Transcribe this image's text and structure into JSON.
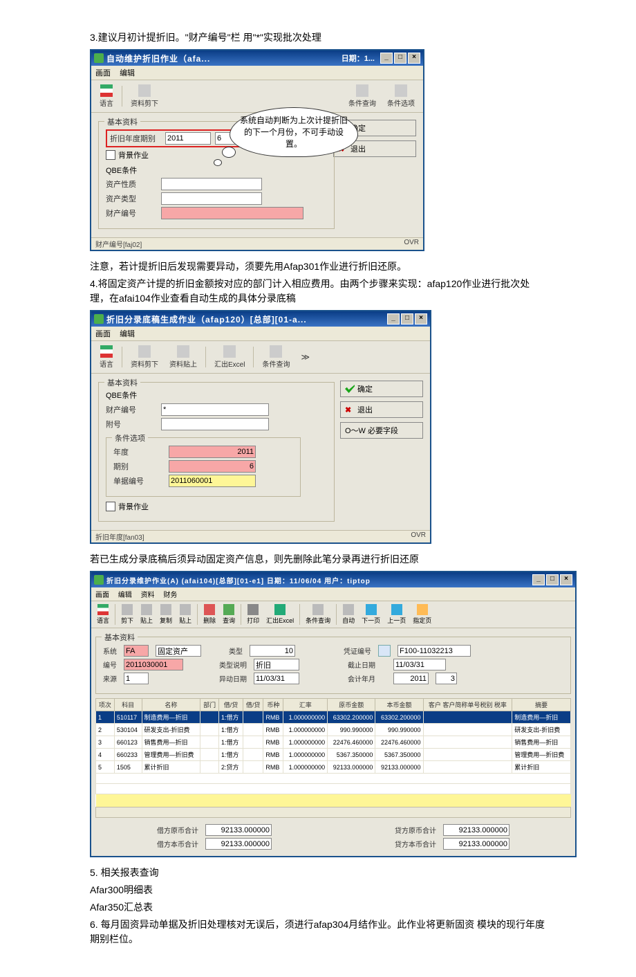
{
  "doc": {
    "p3": "3.建议月初计提折旧。\"财产编号\"栏 用\"*\"实现批次处理",
    "p3_note": "注意，若计提折旧后发现需要异动，须要先用Afap301作业进行折旧还原。",
    "p4": "4.将固定资产计提的折旧金额按对应的部门计入相应费用。由两个步骤来实现：afap120作业进行批次处理，在afai104作业查看自动生成的具体分录底稿",
    "p4b": "若已生成分录底稿后须异动固定资产信息，则先删除此笔分录再进行折旧还原",
    "p5": "5.  相关报表查询",
    "p5a": "Afar300明细表",
    "p5b": "Afar350汇总表",
    "p6": "6.  每月固资异动单据及折旧处理核对无误后，须进行afap304月结作业。此作业将更新固资  模块的现行年度期别栏位。"
  },
  "win1": {
    "title_left": "自动维护折旧作业（afa...",
    "title_right": "日期：1...",
    "menu": [
      "画面",
      "编辑"
    ],
    "toolbar": {
      "lang": "语言",
      "cut": "资料剪下"
    },
    "toolbar_right": {
      "query": "条件查询",
      "cond": "条件选项"
    },
    "speech": "系统自动判断为上次计提折旧的下一个月份，不可手动设置。",
    "group_title": "基本资料",
    "year_label": "折旧年度期别",
    "year": "2011",
    "period": "6",
    "bg_label": "背景作业",
    "qbe_title": "QBE条件",
    "qbe": [
      {
        "label": "资产性质",
        "val": ""
      },
      {
        "label": "资产类型",
        "val": ""
      },
      {
        "label": "财产编号",
        "val": "",
        "pink": true
      }
    ],
    "btns": {
      "ok": "确定",
      "exit": "退出"
    },
    "status_left": "财产编号[faj02]",
    "status_right": "OVR"
  },
  "win2": {
    "title": "折旧分录底稿生成作业（afap120）[总部][01-a...",
    "menu": [
      "画面",
      "编辑"
    ],
    "toolbar": [
      "语言",
      "资料剪下",
      "资料贴上",
      "汇出Excel",
      "条件查询"
    ],
    "group_title": "基本资料",
    "qbe_title": "QBE条件",
    "fld_prop": "财产编号",
    "fld_prop_val": "*",
    "fld_att": "附号",
    "opt_title": "条件选项",
    "opt_year_label": "年度",
    "opt_year": "2011",
    "opt_period_label": "期别",
    "opt_period": "6",
    "opt_docno_label": "单据编号",
    "opt_docno": "2011060001",
    "bg_label": "背景作业",
    "btns": {
      "ok": "确定",
      "exit": "退出",
      "must": "O～W 必要字段"
    },
    "status_left": "折旧年度[fan03]",
    "status_right": "OVR"
  },
  "win3": {
    "title": "折旧分录维护作业(A) (afai104)[总部][01-e1]   日期：11/06/04   用户：tiptop",
    "menu": [
      "画面",
      "编辑",
      "资料",
      "财务"
    ],
    "toolbar": [
      "语言",
      "剪下",
      "贴上",
      "复制",
      "贴上",
      "删除",
      "查询",
      "打印",
      "汇出Excel",
      "条件查询",
      "自动",
      "下一页",
      "上一页",
      "指定页"
    ],
    "group_title": "基本资料",
    "fields": {
      "sys_l": "系统",
      "sys_v": "FA",
      "sys_t": "固定资产",
      "type_l": "类型",
      "type_v": "10",
      "typedet_l": "类型说明",
      "typedet_v": "折旧",
      "voucher_l": "凭证编号",
      "voucher_v": "F100-11032213",
      "no_l": "编号",
      "no_v": "2011030001",
      "cutoff_l": "截止日期",
      "cutoff_v": "11/03/31",
      "src_l": "来源",
      "src_v": "1",
      "movedate_l": "异动日期",
      "movedate_v": "11/03/31",
      "acctym_l": "会计年月",
      "acctym_y": "2011",
      "acctym_m": "3"
    },
    "cols": [
      "项次",
      "科目",
      "名称",
      "部门",
      "借/贷",
      "借/贷",
      "币种",
      "汇率",
      "原币金额",
      "本币金额",
      "客户 客户简称单号税别 税率",
      "摘要"
    ],
    "rows": [
      {
        "seq": "1",
        "subj": "510117",
        "name": "制造费用—折旧",
        "dept": "",
        "dc1": "1:借方",
        "dc2": "RMB",
        "rate": "1.000000000",
        "orig": "63302.200000",
        "local": "63302.200000",
        "cust": "",
        "memo": "制造费用—折旧",
        "sel": true
      },
      {
        "seq": "2",
        "subj": "530104",
        "name": "研发支出-折旧费",
        "dept": "",
        "dc1": "1:借方",
        "dc2": "RMB",
        "rate": "1.000000000",
        "orig": "990.990000",
        "local": "990.990000",
        "cust": "",
        "memo": "研发支出-折旧费"
      },
      {
        "seq": "3",
        "subj": "660123",
        "name": "销售费用—折旧",
        "dept": "",
        "dc1": "1:借方",
        "dc2": "RMB",
        "rate": "1.000000000",
        "orig": "22476.460000",
        "local": "22476.460000",
        "cust": "",
        "memo": "销售费用—折旧"
      },
      {
        "seq": "4",
        "subj": "660233",
        "name": "管理费用—折旧费",
        "dept": "",
        "dc1": "1:借方",
        "dc2": "RMB",
        "rate": "1.000000000",
        "orig": "5367.350000",
        "local": "5367.350000",
        "cust": "",
        "memo": "管理费用—折旧费"
      },
      {
        "seq": "5",
        "subj": "1505",
        "name": "累计折旧",
        "dept": "",
        "dc1": "2:贷方",
        "dc2": "RMB",
        "rate": "1.000000000",
        "orig": "92133.000000",
        "local": "92133.000000",
        "cust": "",
        "memo": "累计折旧"
      }
    ],
    "totals": {
      "dr_orig_l": "借方原币合计",
      "dr_orig": "92133.000000",
      "dr_local_l": "借方本币合计",
      "dr_local": "92133.000000",
      "cr_orig_l": "贷方原币合计",
      "cr_orig": "92133.000000",
      "cr_local_l": "贷方本币合计",
      "cr_local": "92133.000000"
    }
  }
}
